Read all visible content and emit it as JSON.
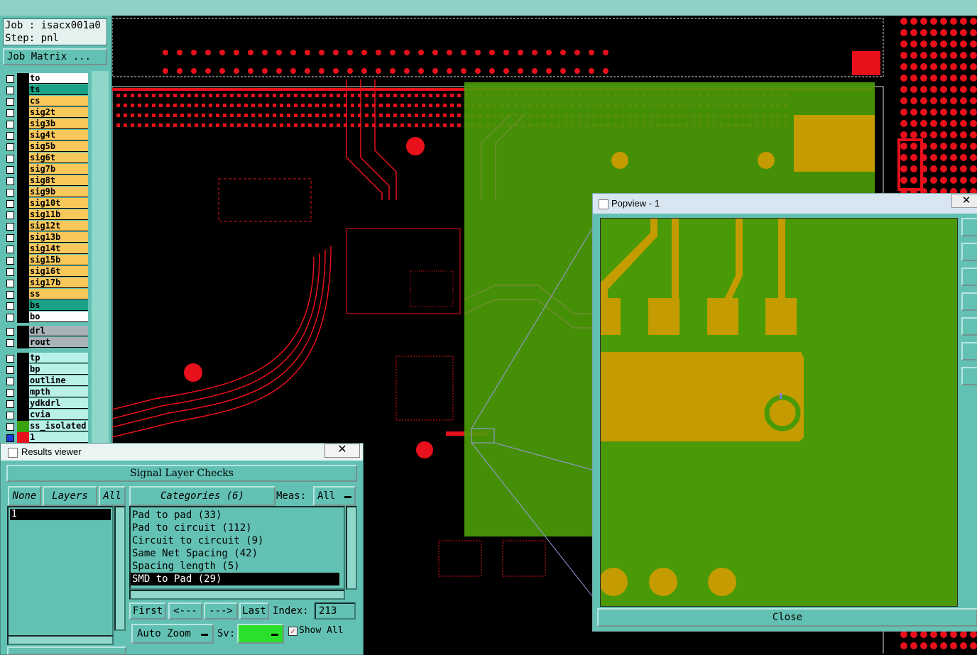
{
  "colors": {
    "teal_panel": "#63c1b3",
    "layer_signal": "#f9c85b",
    "layer_active": "#1aa186",
    "layer_white": "#ffffff",
    "layer_drill": "#a8b3b7",
    "layer_misc": "#b9f0e8",
    "pcb_red": "#e8101a",
    "copper_green": "#4a9a07",
    "pad_gold": "#c49b00"
  },
  "left": {
    "job_label": "Job : isacx001a0",
    "step_label": "Step: pnl",
    "job_matrix_button": "Job Matrix ...",
    "layers": [
      {
        "name": "to",
        "color": "white"
      },
      {
        "name": "ts",
        "color": "active"
      },
      {
        "name": "cs",
        "color": "signal"
      },
      {
        "name": "sig2t",
        "color": "signal"
      },
      {
        "name": "sig3b",
        "color": "signal"
      },
      {
        "name": "sig4t",
        "color": "signal"
      },
      {
        "name": "sig5b",
        "color": "signal"
      },
      {
        "name": "sig6t",
        "color": "signal"
      },
      {
        "name": "sig7b",
        "color": "signal"
      },
      {
        "name": "sig8t",
        "color": "signal"
      },
      {
        "name": "sig9b",
        "color": "signal"
      },
      {
        "name": "sig10t",
        "color": "signal"
      },
      {
        "name": "sig11b",
        "color": "signal"
      },
      {
        "name": "sig12t",
        "color": "signal"
      },
      {
        "name": "sig13b",
        "color": "signal"
      },
      {
        "name": "sig14t",
        "color": "signal"
      },
      {
        "name": "sig15b",
        "color": "signal"
      },
      {
        "name": "sig16t",
        "color": "signal"
      },
      {
        "name": "sig17b",
        "color": "signal"
      },
      {
        "name": "ss",
        "color": "signal"
      },
      {
        "name": "bs",
        "color": "active"
      },
      {
        "name": "bo",
        "color": "white"
      }
    ],
    "drill_layers": [
      {
        "name": "drl",
        "color": "drill"
      },
      {
        "name": "rout",
        "color": "drill"
      }
    ],
    "misc_layers": [
      {
        "name": "tp",
        "color": "misc"
      },
      {
        "name": "bp",
        "color": "misc"
      },
      {
        "name": "outline",
        "color": "misc"
      },
      {
        "name": "mpth",
        "color": "misc"
      },
      {
        "name": "ydkdrl",
        "color": "misc"
      },
      {
        "name": "cvia",
        "color": "misc"
      },
      {
        "name": "ss_isolated",
        "color": "misc",
        "swatch": "green"
      },
      {
        "name": "1",
        "color": "misc",
        "swatch": "red"
      }
    ]
  },
  "results": {
    "window_title": "Results viewer",
    "close_glyph": "✕",
    "header": "Signal Layer Checks",
    "none_button": "None",
    "layers_button": "Layers",
    "all_button": "All",
    "layer_items": [
      "1"
    ],
    "categories_button": "Categories (6)",
    "meas_label": "Meas:",
    "meas_value": "All",
    "categories": [
      "Pad to pad (33)",
      "Pad to circuit (112)",
      "Circuit to circuit (9)",
      "Same Net Spacing (42)",
      "Spacing length (5)",
      "SMD to Pad (29)"
    ],
    "selected_category": 5,
    "first_button": "First",
    "prev_button": "<---",
    "next_button": "--->",
    "last_button": "Last",
    "index_label": "Index:",
    "index_value": "213",
    "autozoom_button": "Auto Zoom",
    "sv_label": "Sv:",
    "show_all_label": "Show All",
    "show_all_checked": true
  },
  "popview": {
    "title": "Popview - 1",
    "close_glyph": "✕",
    "close_button": "Close"
  }
}
